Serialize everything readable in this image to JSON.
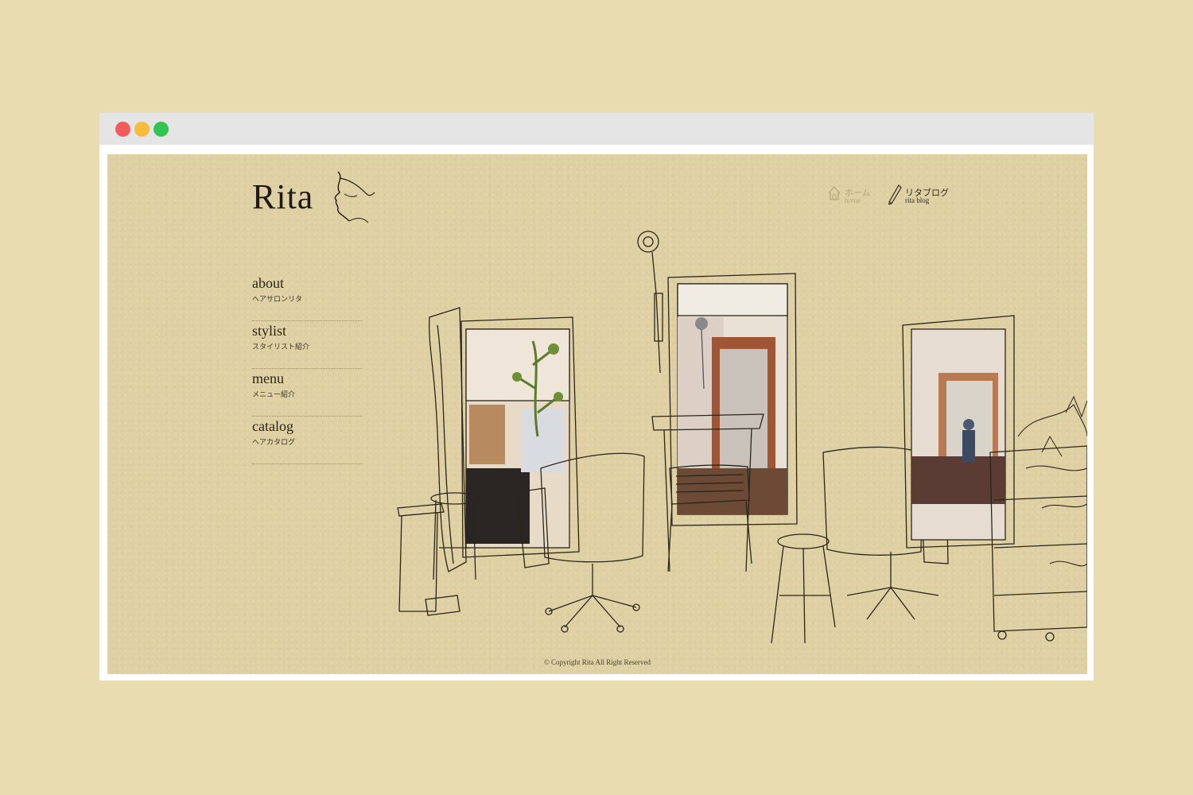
{
  "window": {
    "controls": [
      "close",
      "minimize",
      "maximize"
    ]
  },
  "header": {
    "logo_text": "Rita",
    "top_nav": [
      {
        "jp": "ホーム",
        "en": "home",
        "icon": "house-icon"
      },
      {
        "jp": "リタブログ",
        "en": "rita blog",
        "icon": "pencil-icon"
      }
    ]
  },
  "sidebar": {
    "items": [
      {
        "en": "about",
        "jp": "ヘアサロンリタ"
      },
      {
        "en": "stylist",
        "jp": "スタイリスト紹介"
      },
      {
        "en": "menu",
        "jp": "メニュー紹介"
      },
      {
        "en": "catalog",
        "jp": "ヘアカタログ"
      }
    ]
  },
  "footer": {
    "copyright": "© Copyright Rita All Right Reserved"
  },
  "colors": {
    "page_bg": "#e8dcb0",
    "paper": "#dfd0a4",
    "ink": "#1d1a14",
    "muted": "#b3a67f"
  }
}
